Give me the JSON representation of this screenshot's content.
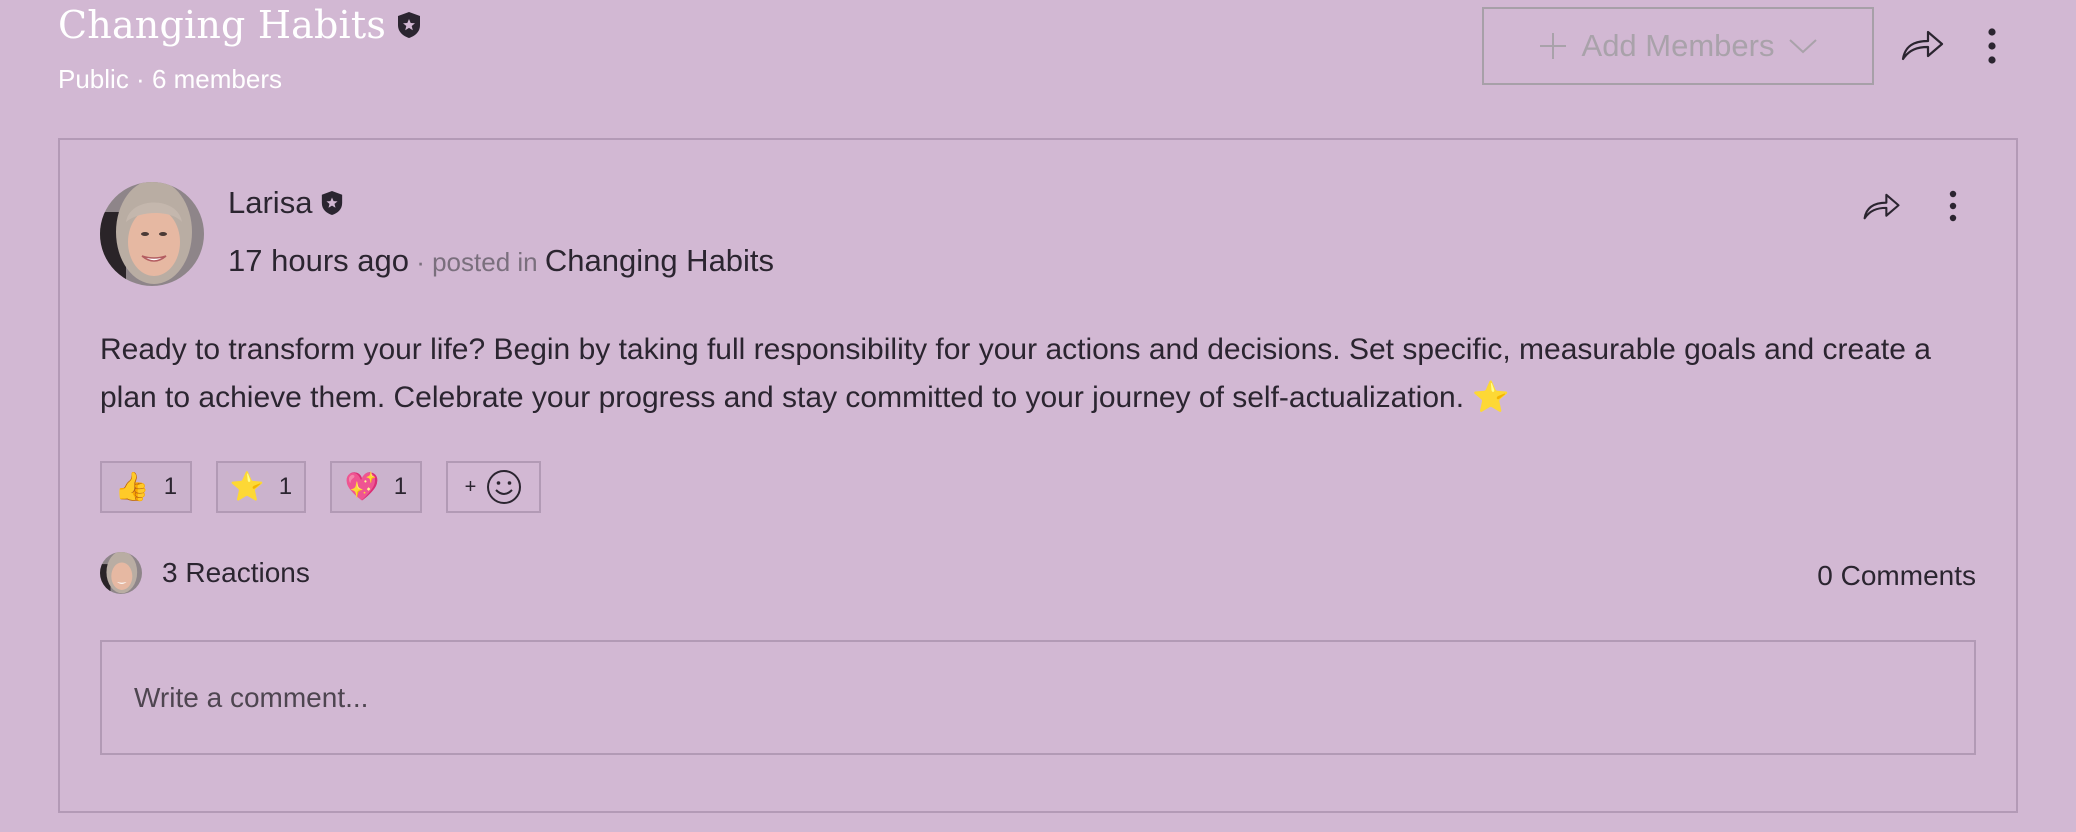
{
  "group": {
    "title": "Changing Habits",
    "privacy": "Public",
    "separator": " · ",
    "members": "6 members"
  },
  "header_actions": {
    "add_members_label": "Add Members",
    "share_icon": "share-arrow-icon",
    "more_icon": "vertical-ellipsis-icon"
  },
  "post": {
    "author": "Larisa",
    "author_badge": "admin-shield-star-icon",
    "time": "17 hours ago",
    "posted_in_label": " · posted in ",
    "group_link": "Changing Habits",
    "body": "Ready to transform your life? Begin by taking full responsibility for your actions and decisions. Set specific, measurable goals and create a plan to achieve them. Celebrate your progress and stay committed to your journey of self-actualization. ⭐",
    "reactions": [
      {
        "emoji": "👍",
        "name": "thumbs-up",
        "count": "1"
      },
      {
        "emoji": "⭐",
        "name": "star",
        "count": "1"
      },
      {
        "emoji": "💖",
        "name": "sparkling-heart",
        "count": "1"
      }
    ],
    "add_reaction_plus": "+",
    "reactions_summary": "3 Reactions",
    "comments_summary": "0 Comments",
    "comment_placeholder": "Write a comment..."
  },
  "colors": {
    "background": "#d2b8d3",
    "border": "#b29ab5",
    "text": "#2b2530",
    "muted": "#7a6f7d",
    "disabled": "#a9a2aa"
  }
}
